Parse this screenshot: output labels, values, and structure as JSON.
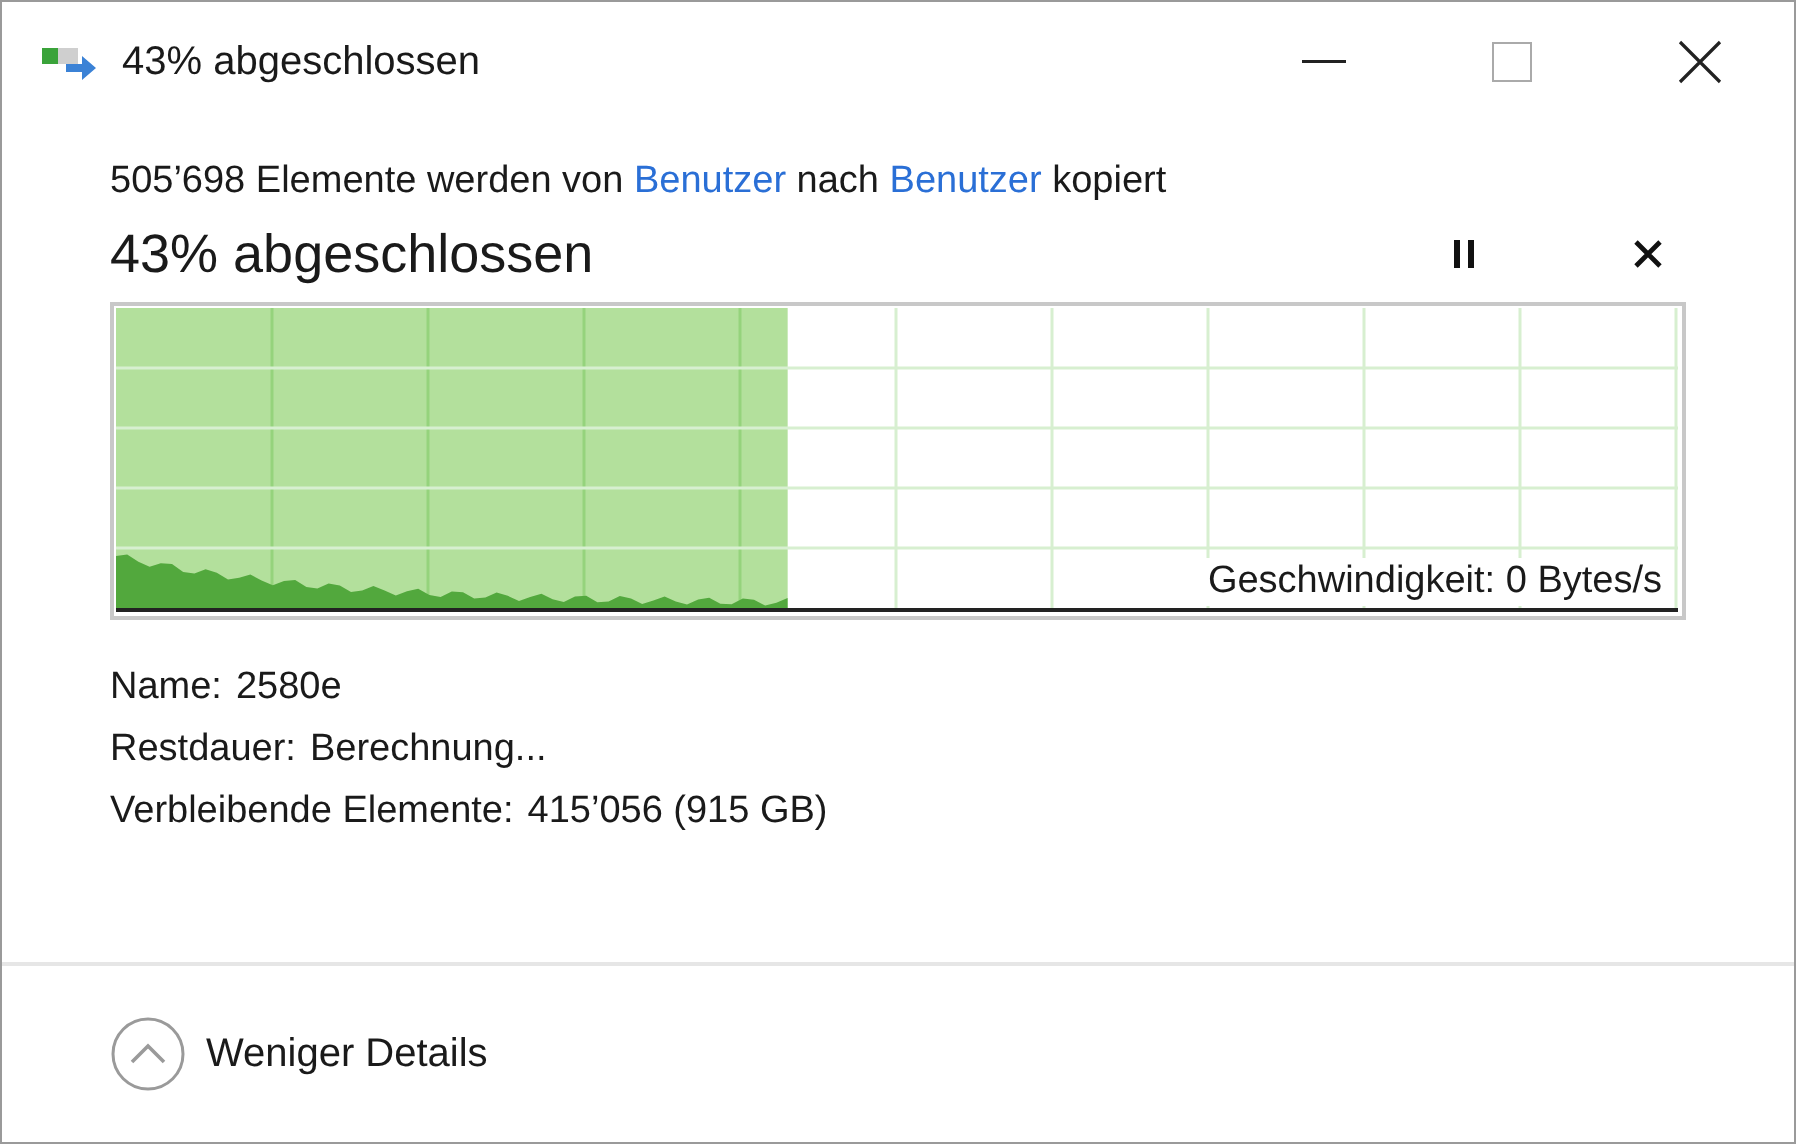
{
  "window": {
    "title": "43% abgeschlossen"
  },
  "summary": [
    {
      "kind": "text",
      "text": "505’698 Elemente werden von"
    },
    {
      "kind": "link",
      "text": "Benutzer"
    },
    {
      "kind": "text",
      "text": "nach"
    },
    {
      "kind": "link",
      "text": "Benutzer"
    },
    {
      "kind": "text",
      "text": "kopiert"
    }
  ],
  "progress": {
    "heading": "43% abgeschlossen",
    "level": 0.43,
    "speed": "Geschwindigkeit: 0 Bytes/s"
  },
  "details": [
    {
      "label": "Name:",
      "value": "2580e"
    },
    {
      "label": "Restdauer:",
      "value": "Berechnung..."
    },
    {
      "label": "Verbleibende Elemente:",
      "value": "415’056 (915 GB)"
    }
  ],
  "footer": {
    "toggle": "Weniger Details",
    "expanded": true
  }
}
